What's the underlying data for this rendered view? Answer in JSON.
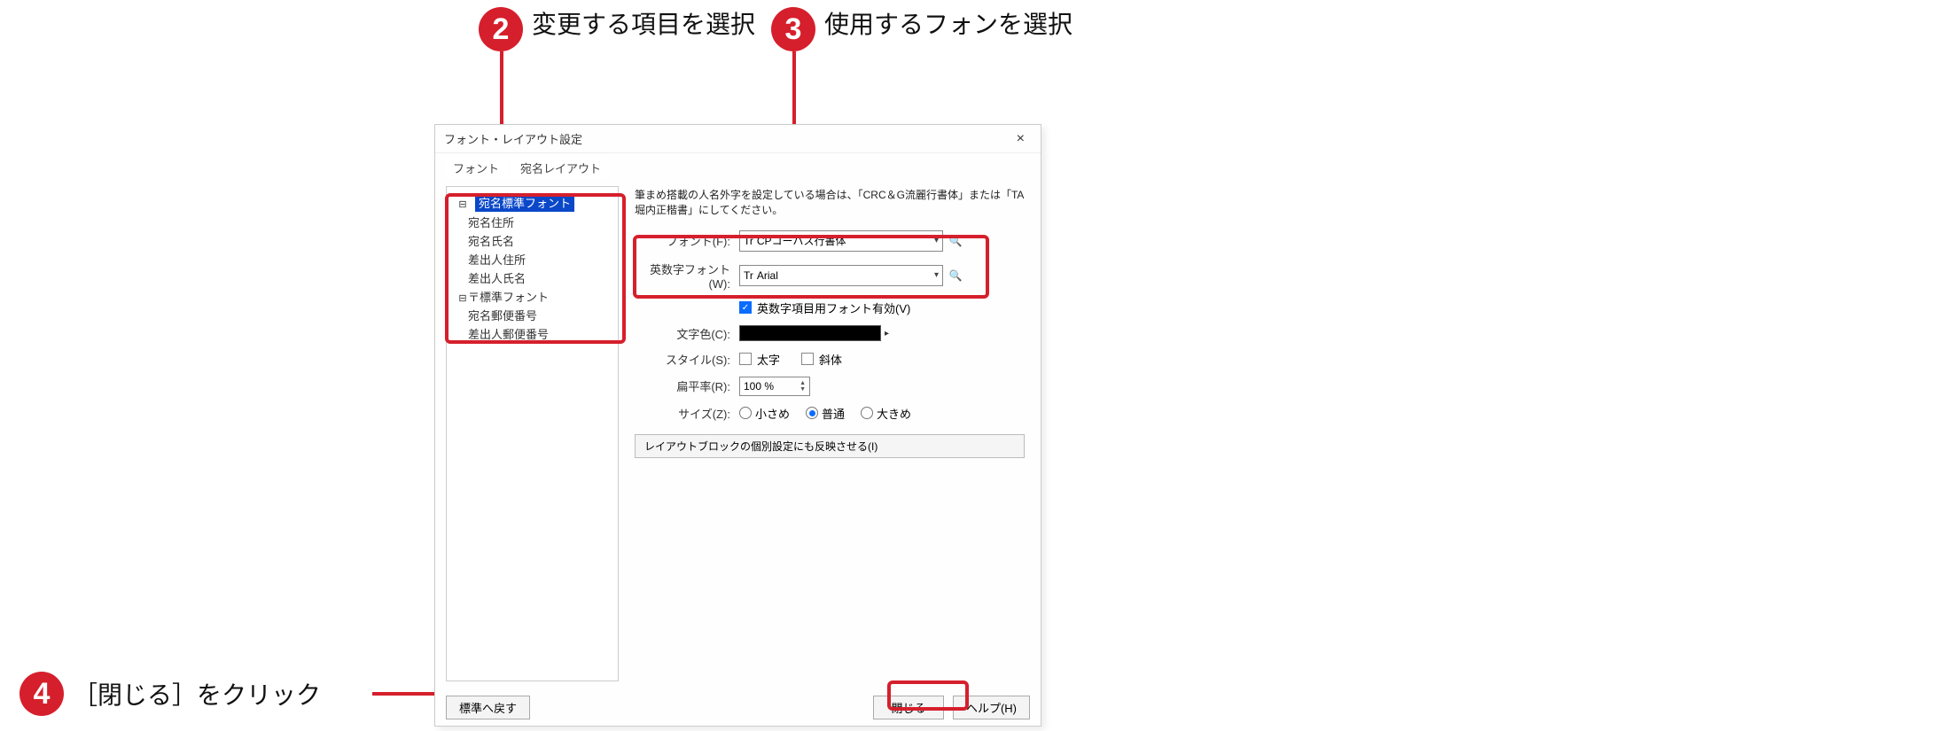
{
  "callouts": {
    "c2": "変更する項目を選択",
    "c3": "使用するフォンを選択",
    "c4": "［閉じる］をクリック",
    "n2": "2",
    "n3": "3",
    "n4": "4"
  },
  "dialog": {
    "title": "フォント・レイアウト設定",
    "tab_font": "フォント",
    "tab_layout": "宛名レイアウト",
    "hint": "筆まめ搭載の人名外字を設定している場合は、「CRC＆G流麗行書体」または「TA堀内正楷書」にしてください。",
    "tree": {
      "root1": "宛名標準フォント",
      "i1": "宛名住所",
      "i2": "宛名氏名",
      "i3": "差出人住所",
      "i4": "差出人氏名",
      "root2": "〒標準フォント",
      "i5": "宛名郵便番号",
      "i6": "差出人郵便番号"
    },
    "labels": {
      "font": "フォント(F):",
      "alnum_font": "英数字フォント(W):",
      "alnum_enable": "英数字項目用フォント有効(V)",
      "color": "文字色(C):",
      "style": "スタイル(S):",
      "bold": "太字",
      "italic": "斜体",
      "flatten": "扁平率(R):",
      "size": "サイズ(Z):",
      "size_s": "小さめ",
      "size_m": "普通",
      "size_l": "大きめ"
    },
    "values": {
      "font_val": "CPコーバス行書体",
      "alnum_val": "Arial",
      "flatten_val": "100 %"
    },
    "layout_btn": "レイアウトブロックの個別設定にも反映させる(I)",
    "footer": {
      "reset": "標準へ戻す",
      "close": "閉じる",
      "help": "ヘルプ(H)"
    }
  }
}
